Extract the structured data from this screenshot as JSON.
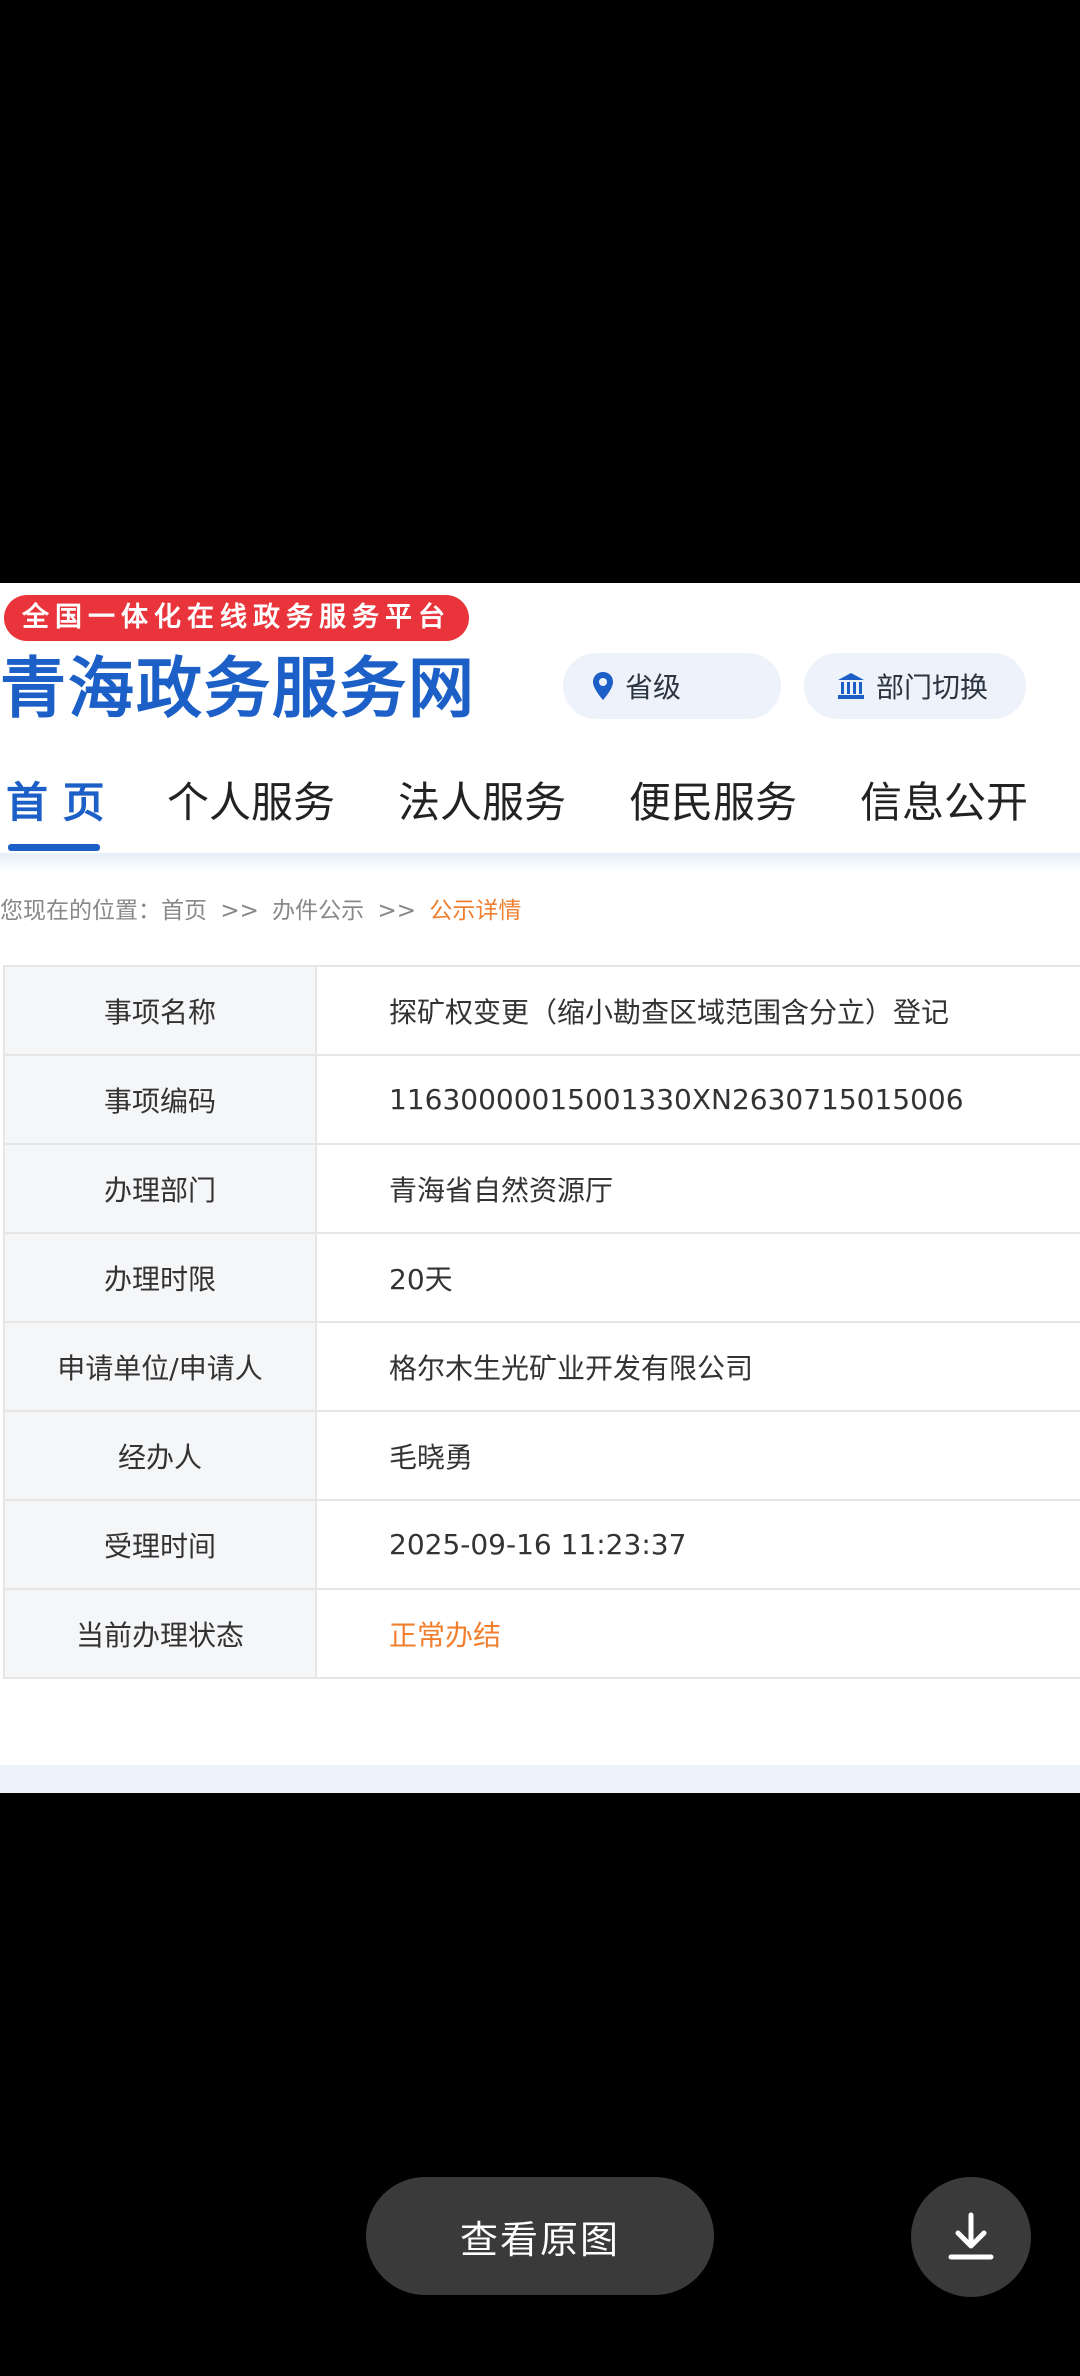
{
  "header": {
    "badge_text": "全国一体化在线政务服务平台",
    "site_title": "青海政务服务网",
    "region_label": "省级",
    "dept_label": "部门切换"
  },
  "nav": {
    "items": [
      "首 页",
      "个人服务",
      "法人服务",
      "便民服务",
      "信息公开"
    ],
    "active_index": 0
  },
  "breadcrumb": {
    "prefix": "您现在的位置：",
    "home": "首页",
    "separator": ">>",
    "section": "办件公示",
    "current": "公示详情"
  },
  "details": [
    {
      "label": "事项名称",
      "value": "探矿权变更（缩小勘查区域范围含分立）登记"
    },
    {
      "label": "事项编码",
      "value": "11630000015001330XN2630715015006"
    },
    {
      "label": "办理部门",
      "value": "青海省自然资源厅"
    },
    {
      "label": "办理时限",
      "value": "20天"
    },
    {
      "label": "申请单位/申请人",
      "value": "格尔木生光矿业开发有限公司"
    },
    {
      "label": "经办人",
      "value": "毛晓勇"
    },
    {
      "label": "受理时间",
      "value": "2025-09-16 11:23:37"
    },
    {
      "label": "当前办理状态",
      "value": "正常办结"
    }
  ],
  "viewer": {
    "view_original_label": "查看原图"
  },
  "colors": {
    "brand_blue": "#1c5fc7",
    "badge_red": "#e8343a",
    "status_orange": "#f08030"
  },
  "icons": {
    "region": "location-pin-icon",
    "dept": "building-icon",
    "download": "download-icon"
  }
}
